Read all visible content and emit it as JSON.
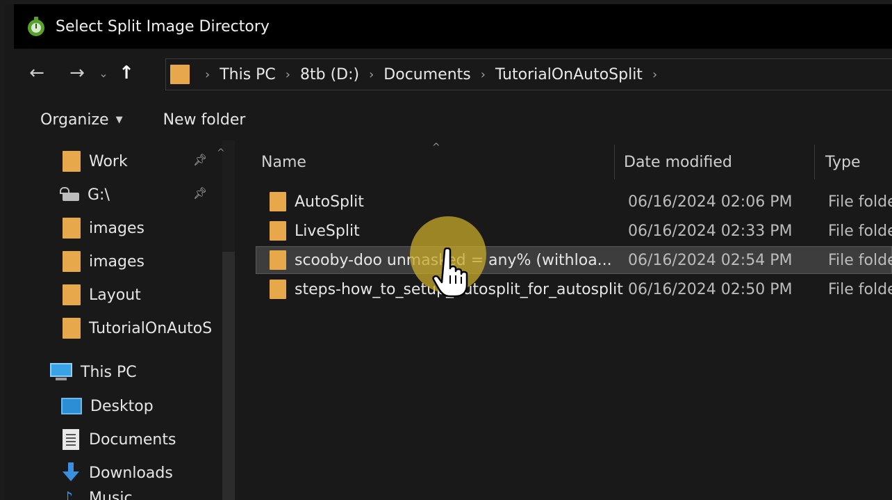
{
  "window": {
    "title": "Select Split Image Directory"
  },
  "nav": {
    "back_icon": "arrow-left-icon",
    "forward_icon": "arrow-right-icon",
    "recent_icon": "chevron-down-icon",
    "up_icon": "arrow-up-icon",
    "breadcrumbs": [
      "This PC",
      "8tb (D:)",
      "Documents",
      "TutorialOnAutoSplit"
    ]
  },
  "toolbar": {
    "organize_label": "Organize",
    "new_folder_label": "New folder"
  },
  "sidebar": {
    "items": [
      {
        "label": "Work",
        "icon": "folder-icon",
        "pinned": true
      },
      {
        "label": "G:\\",
        "icon": "drive-icon",
        "pinned": true
      },
      {
        "label": "images",
        "icon": "folder-icon"
      },
      {
        "label": "images",
        "icon": "folder-icon"
      },
      {
        "label": "Layout",
        "icon": "folder-icon"
      },
      {
        "label": "TutorialOnAutoS",
        "icon": "folder-icon"
      },
      {
        "label": "This PC",
        "icon": "computer-icon"
      },
      {
        "label": "Desktop",
        "icon": "desktop-icon"
      },
      {
        "label": "Documents",
        "icon": "documents-icon"
      },
      {
        "label": "Downloads",
        "icon": "downloads-icon"
      },
      {
        "label": "Music",
        "icon": "music-icon"
      }
    ]
  },
  "columns": {
    "name": "Name",
    "date": "Date modified",
    "type": "Type"
  },
  "files": [
    {
      "name": "AutoSplit",
      "date": "06/16/2024 02:06 PM",
      "type": "File folde"
    },
    {
      "name": "LiveSplit",
      "date": "06/16/2024 02:33 PM",
      "type": "File folde"
    },
    {
      "name": "scooby-doo unmasked = any% (withloa...",
      "date": "06/16/2024 02:54 PM",
      "type": "File folde",
      "selected": true
    },
    {
      "name": "steps-how_to_setup_autosplit_for_autosplit",
      "date": "06/16/2024 02:50 PM",
      "type": "File folde"
    }
  ],
  "colors": {
    "folder": "#e6a84b",
    "selection": "#3d3d3d",
    "cursor_halo": "#c8aa28"
  }
}
